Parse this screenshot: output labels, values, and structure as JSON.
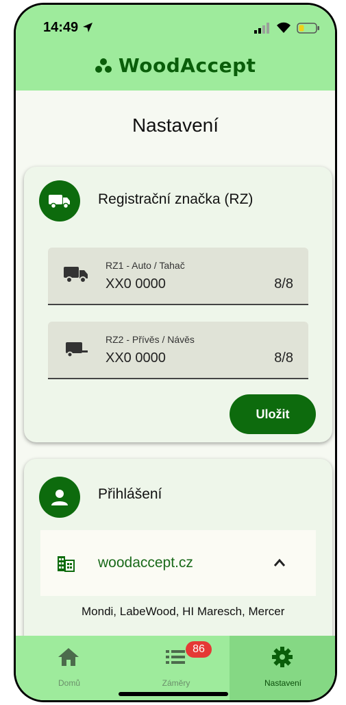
{
  "status_bar": {
    "time": "14:49"
  },
  "app": {
    "brand": "WoodAccept"
  },
  "page": {
    "title": "Nastavení"
  },
  "registration_card": {
    "title": "Registrační značka (RZ)",
    "fields": [
      {
        "label": "RZ1 - Auto / Tahač",
        "value": "XX0 0000",
        "counter": "8/8",
        "icon": "truck-icon"
      },
      {
        "label": "RZ2 - Přívěs / Návěs",
        "value": "XX0 0000",
        "counter": "8/8",
        "icon": "trailer-icon"
      }
    ],
    "save_label": "Uložit"
  },
  "login_card": {
    "title": "Přihlášení",
    "account": {
      "name": "woodaccept.cz",
      "icon": "building-icon"
    },
    "companies": "Mondi, LabeWood, HI Maresch, Mercer"
  },
  "bottom_nav": {
    "items": [
      {
        "label": "Domů",
        "icon": "home-icon"
      },
      {
        "label": "Záměry",
        "icon": "list-icon",
        "badge": "86"
      },
      {
        "label": "Nastavení",
        "icon": "settings-icon",
        "active": true
      }
    ]
  },
  "colors": {
    "accent": "#0d6b0d",
    "topbar": "#9eeb9c",
    "badge": "#e53935"
  }
}
